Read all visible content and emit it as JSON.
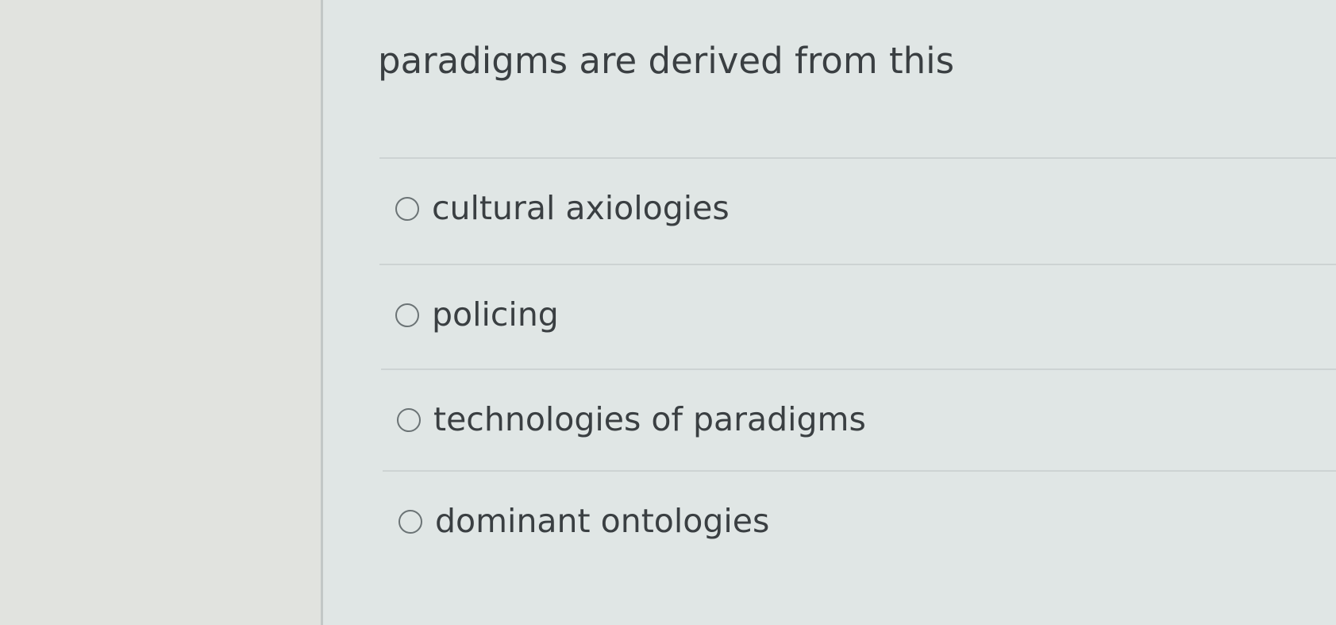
{
  "question": {
    "text": "paradigms are derived from this"
  },
  "options": [
    {
      "label": "cultural axiologies",
      "selected": false
    },
    {
      "label": "policing",
      "selected": false
    },
    {
      "label": "technologies of paradigms",
      "selected": false
    },
    {
      "label": "dominant ontologies",
      "selected": false
    }
  ]
}
